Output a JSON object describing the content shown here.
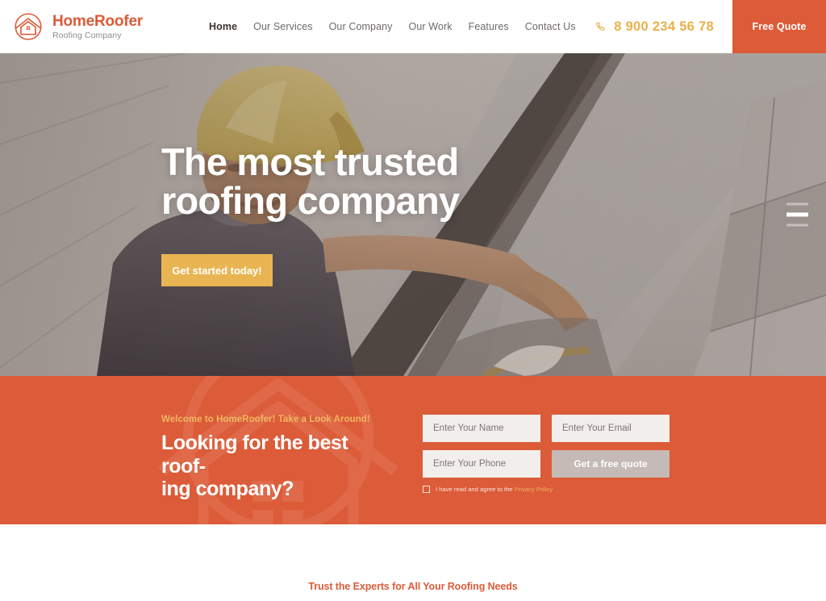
{
  "header": {
    "logo": {
      "icon": "house-in-circle-logo-icon",
      "name": "HomeRoofer",
      "tagline": "Roofing Company"
    },
    "nav": [
      {
        "label": "Home",
        "active": true
      },
      {
        "label": "Our Services",
        "active": false
      },
      {
        "label": "Our Company",
        "active": false
      },
      {
        "label": "Our Work",
        "active": false
      },
      {
        "label": "Features",
        "active": false
      },
      {
        "label": "Contact Us",
        "active": false
      }
    ],
    "phone": {
      "icon": "phone-icon",
      "number": "8 900 234 56 78",
      "color": "#E8B14C"
    },
    "quote_button": {
      "label": "Free Quote",
      "color": "#DC5B38"
    }
  },
  "hero": {
    "title_line1": "The most trusted",
    "title_line2": "roofing company",
    "cta_label": "Get started today!",
    "cta_color": "#E8B552",
    "image_alt": "Roofer in yellow hard hat working on a grey shingle roof",
    "slider": {
      "dots": [
        "slide-1",
        "slide-2",
        "slide-3"
      ],
      "active_index": 1
    }
  },
  "band": {
    "background_color": "#DC5B38",
    "eyebrow": "Welcome to HomeRoofer! Take a Look Around!",
    "heading_line1": "Looking for the best roof-",
    "heading_line2": "ing company?",
    "form": {
      "name_placeholder": "Enter Your Name",
      "name_value": "",
      "email_placeholder": "Enter Your Email",
      "email_value": "",
      "phone_placeholder": "Enter Your Phone",
      "phone_value": "",
      "submit_label": "Get a free quote",
      "submit_color": "#C5BAB6",
      "consent_text": "I have read and agree to the",
      "consent_link": "Privacy Policy",
      "consent_checked": false
    }
  },
  "below": {
    "tagline": "Trust the Experts for All Your Roofing Needs",
    "color": "#DC5B38"
  }
}
